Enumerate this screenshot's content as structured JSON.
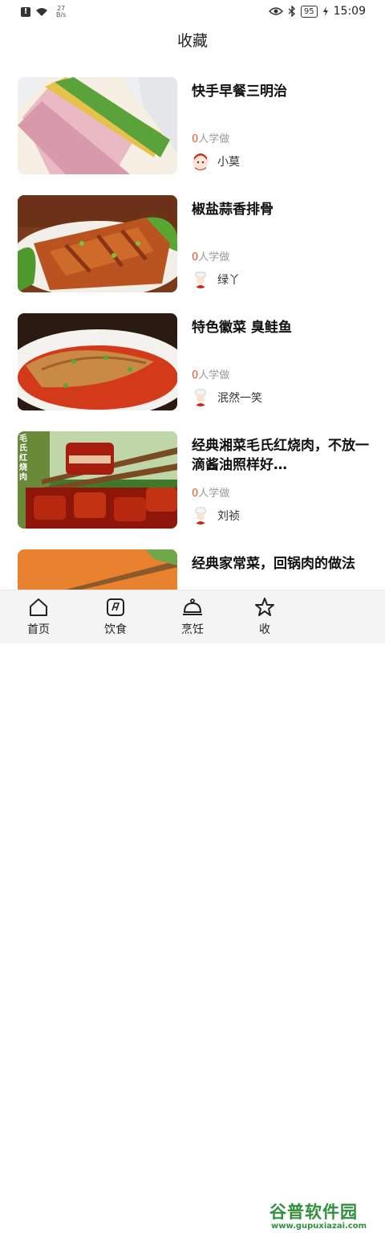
{
  "status": {
    "net_speed_top": "27",
    "net_speed_unit": "B/s",
    "battery": "95",
    "time": "15:09"
  },
  "page": {
    "title": "收藏"
  },
  "recipes": [
    {
      "title": "快手早餐三明治",
      "count": "0",
      "learn_suffix": "人学做",
      "author": "小莫"
    },
    {
      "title": "椒盐蒜香排骨",
      "count": "0",
      "learn_suffix": "人学做",
      "author": "绿丫"
    },
    {
      "title": "特色徽菜 臭鲑鱼",
      "count": "0",
      "learn_suffix": "人学做",
      "author": "泯然一笑"
    },
    {
      "title": "经典湘菜毛氏红烧肉，不放一滴酱油照样好…",
      "count": "0",
      "learn_suffix": "人学做",
      "author": "刘祯",
      "image_text": "毛氏红烧肉"
    },
    {
      "title": "经典家常菜，回锅肉的做法"
    }
  ],
  "nav": [
    {
      "label": "首页",
      "icon": "home-icon"
    },
    {
      "label": "饮食",
      "icon": "notebook-icon"
    },
    {
      "label": "烹饪",
      "icon": "cloche-icon"
    },
    {
      "label": "收",
      "icon": "star-icon"
    }
  ],
  "watermark": {
    "big": "谷普软件园",
    "small": "www.gupuxiazai.com"
  }
}
